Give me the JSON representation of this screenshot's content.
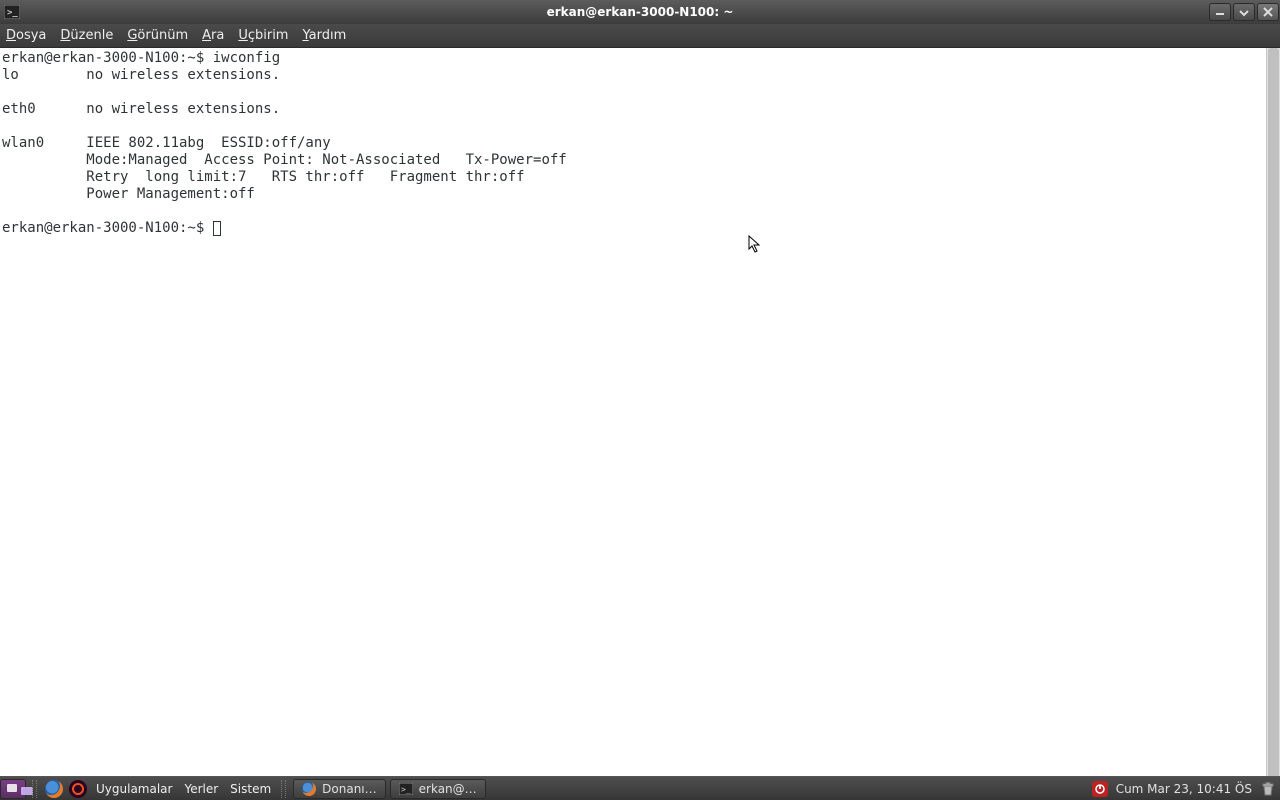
{
  "window": {
    "title": "erkan@erkan-3000-N100: ~"
  },
  "menu": {
    "dosya_u": "D",
    "dosya_r": "osya",
    "duzenle_u": "D",
    "duzenle_r": "üzenle",
    "gorunum_u": "G",
    "gorunum_r": "örünüm",
    "ara_u": "A",
    "ara_r": "ra",
    "ucbirim_u": "U",
    "ucbirim_r": "çbirim",
    "yardim_u": "Y",
    "yardim_r": "ardım"
  },
  "terminal": {
    "line1": "erkan@erkan-3000-N100:~$ iwconfig",
    "line2": "lo        no wireless extensions.",
    "line3": "",
    "line4": "eth0      no wireless extensions.",
    "line5": "",
    "line6": "wlan0     IEEE 802.11abg  ESSID:off/any  ",
    "line7": "          Mode:Managed  Access Point: Not-Associated   Tx-Power=off   ",
    "line8": "          Retry  long limit:7   RTS thr:off   Fragment thr:off",
    "line9": "          Power Management:off",
    "line10": "          ",
    "prompt2": "erkan@erkan-3000-N100:~$ "
  },
  "panel": {
    "uygulamalar": "Uygulamalar",
    "yerler": "Yerler",
    "sistem": "Sistem",
    "task1": "Donanı…",
    "task2": "erkan@…",
    "clock": "Cum Mar 23, 10:41 ÖS"
  }
}
